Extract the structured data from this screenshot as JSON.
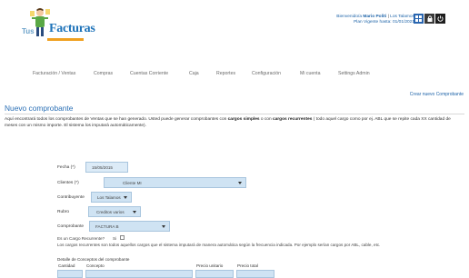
{
  "header": {
    "logo_prefix": "Tus",
    "logo_name": "Facturas",
    "greeting_prefix": "Bienvenido/a",
    "user_name": "Mario Politi",
    "separator": "|",
    "company": "Los Talamos",
    "plan_prefix": "Plan Vigente hasta:",
    "plan_date": "01/01/2021"
  },
  "nav": {
    "items": [
      "Facturación / Ventas",
      "Compras",
      "Cuentas Corriente",
      "Caja",
      "Reportes",
      "Configuración",
      "Mi cuenta",
      "Settings Admin"
    ]
  },
  "content": {
    "create_link": "Crear nuevo Comprobante",
    "title": "Nuevo comprobante",
    "desc_1": "Aquí encontrará todos los comprobantes de Ventas que se han generado. Usted puede generar comprobantes con ",
    "desc_bold_1": "cargos simples",
    "desc_2": " o con ",
    "desc_bold_2": "cargos recurrentes",
    "desc_3": " ( todo aquel cargo como por ej. ABL que se repite cada XX cantidad de meses con un mismo importe. El sistema los imputará automáticamente)."
  },
  "form": {
    "fecha_label": "Fecha (*)",
    "fecha_value": "15/05/2015",
    "clientes_label": "Clientes (*)",
    "clientes_value": "Cliente MI",
    "contribuyente_label": "Contribuyente",
    "contribuyente_value": "Los Talamos",
    "rubro_label": "Rubro",
    "rubro_value": "Creditos varios",
    "comprobante_label": "Comprobante",
    "comprobante_value": "FACTURA B",
    "recurrente_label": "Es un Cargo Recurrente?",
    "recurrente_si": "Si",
    "recurrente_note": "Los cargos recurrentes son todos aquellos cargos que el sistema imputará de manera automática según la frecuencia indicada. Por ejemplo serían cargos por ABL, cable, etc."
  },
  "details": {
    "title": "Detalle de Conceptos del comprobante",
    "columns": [
      "Cantidad",
      "Concepto",
      "Precio unitario",
      "Precio total"
    ]
  },
  "colors": {
    "accent": "#2a6fb5",
    "field_bg": "#cfe3f3",
    "nav_text": "#6a6a6a"
  }
}
